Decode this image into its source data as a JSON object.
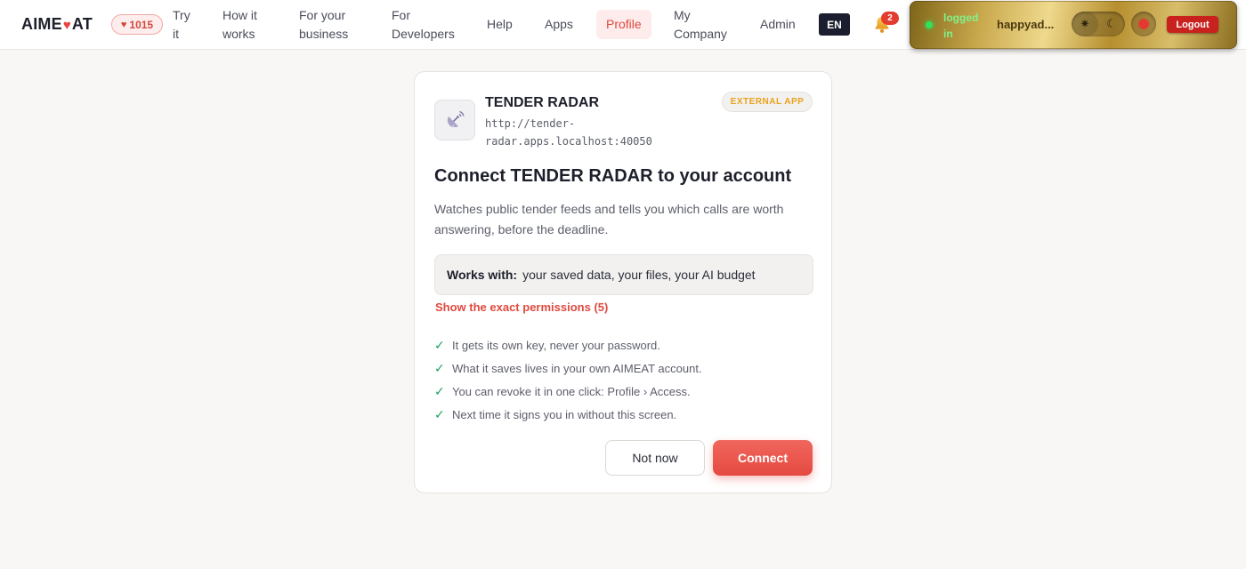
{
  "nav": {
    "logo_left": "AIME",
    "logo_right": "AT",
    "likes_count": "1015",
    "links": [
      {
        "line1": "Try",
        "line2": "it"
      },
      {
        "line1": "How it",
        "line2": "works"
      },
      {
        "line1": "For your",
        "line2": "business"
      },
      {
        "line1": "For",
        "line2": "Developers"
      },
      {
        "line1": "Help"
      },
      {
        "line1": "Apps"
      },
      {
        "line1": "Profile",
        "active": true
      },
      {
        "line1": "My",
        "line2": "Company"
      },
      {
        "line1": "Admin"
      }
    ],
    "language": "EN",
    "notifications_count": "2"
  },
  "session": {
    "status_line1": "logged",
    "status_line2": "in",
    "username": "happyad...",
    "theme_light_icon": "sun-icon",
    "theme_dark_icon": "moon-icon",
    "logout_label": "Logout"
  },
  "consent": {
    "app_icon": "satellite-dish-icon",
    "app_name": "TENDER RADAR",
    "app_url_line1": "http://tender-",
    "app_url_line2": "radar.apps.localhost:40050",
    "badge": "EXTERNAL APP",
    "title": "Connect TENDER RADAR to your account",
    "description": "Watches public tender feeds and tells you which calls are worth answering, before the deadline.",
    "works_with_label": "Works with:",
    "works_with_value": "your saved data, your files, your AI budget",
    "permissions_link": "Show the exact permissions (5)",
    "assurances": [
      "It gets its own key, never your password.",
      "What it saves lives in your own AIMEAT account.",
      "You can revoke it in one click: Profile › Access.",
      "Next time it signs you in without this screen."
    ],
    "cancel_label": "Not now",
    "connect_label": "Connect"
  },
  "colors": {
    "accent": "#e54a41",
    "check": "#1aa15b",
    "badge_text": "#e9a21b"
  }
}
